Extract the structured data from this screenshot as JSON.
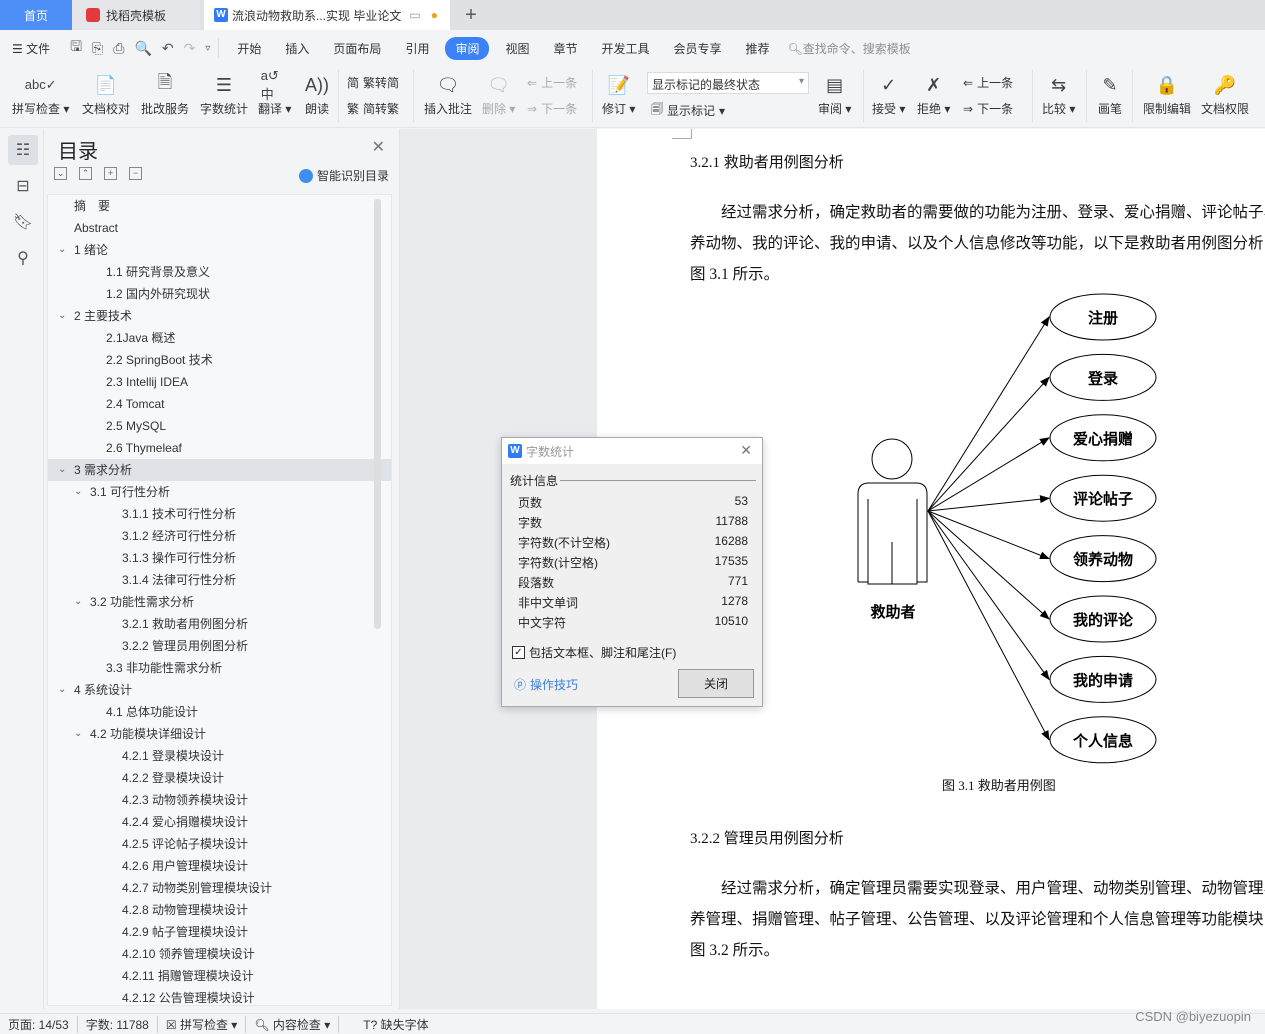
{
  "tabs": {
    "home": "首页",
    "template": "找稻壳模板",
    "document": "流浪动物救助系...实现 毕业论文",
    "add": "+"
  },
  "menu": {
    "file": "文件",
    "items": [
      "开始",
      "插入",
      "页面布局",
      "引用",
      "审阅",
      "视图",
      "章节",
      "开发工具",
      "会员专享",
      "推荐"
    ],
    "active": "审阅",
    "search_placeholder": "查找命令、搜索模板"
  },
  "ribbon": {
    "spell_check": "拼写检查",
    "doc_proof": "文档校对",
    "revise_service": "批改服务",
    "word_count": "字数统计",
    "translate": "翻译",
    "read_aloud": "朗读",
    "trad_to_simp": "繁转简",
    "simp_to_trad": "简转繁",
    "insert_comment": "插入批注",
    "delete": "删除",
    "prev_comment": "上一条",
    "next_comment": "下一条",
    "track_changes": "修订",
    "markup_state": "显示标记的最终状态",
    "show_markup": "显示标记",
    "review": "审阅",
    "accept": "接受",
    "reject": "拒绝",
    "prev_change": "上一条",
    "next_change": "下一条",
    "compare": "比较",
    "pen": "画笔",
    "restrict_edit": "限制编辑",
    "doc_permission": "文档权限"
  },
  "toc": {
    "title": "目录",
    "smart_detect": "智能识别目录",
    "items": [
      {
        "label": "摘　要",
        "level": 0,
        "chevron": false
      },
      {
        "label": "Abstract",
        "level": 0,
        "chevron": false
      },
      {
        "label": "1  绪论",
        "level": 0,
        "chevron": true
      },
      {
        "label": "1.1 研究背景及意义",
        "level": 1,
        "chevron": false
      },
      {
        "label": "1.2 国内外研究现状",
        "level": 1,
        "chevron": false
      },
      {
        "label": "2  主要技术",
        "level": 0,
        "chevron": true
      },
      {
        "label": "2.1Java 概述",
        "level": 1,
        "chevron": false
      },
      {
        "label": "2.2 SpringBoot 技术",
        "level": 1,
        "chevron": false
      },
      {
        "label": "2.3 Intellij IDEA",
        "level": 1,
        "chevron": false
      },
      {
        "label": "2.4 Tomcat",
        "level": 1,
        "chevron": false
      },
      {
        "label": "2.5 MySQL",
        "level": 1,
        "chevron": false
      },
      {
        "label": "2.6 Thymeleaf",
        "level": 1,
        "chevron": false
      },
      {
        "label": "3  需求分析",
        "level": 0,
        "chevron": true,
        "selected": true
      },
      {
        "label": "3.1 可行性分析",
        "level": 1,
        "chevron": true
      },
      {
        "label": "3.1.1  技术可行性分析",
        "level": 2,
        "chevron": false
      },
      {
        "label": "3.1.2  经济可行性分析",
        "level": 2,
        "chevron": false
      },
      {
        "label": "3.1.3  操作可行性分析",
        "level": 2,
        "chevron": false
      },
      {
        "label": "3.1.4  法律可行性分析",
        "level": 2,
        "chevron": false
      },
      {
        "label": "3.2  功能性需求分析",
        "level": 1,
        "chevron": true
      },
      {
        "label": "3.2.1 救助者用例图分析",
        "level": 2,
        "chevron": false
      },
      {
        "label": "3.2.2  管理员用例图分析",
        "level": 2,
        "chevron": false
      },
      {
        "label": "3.3  非功能性需求分析",
        "level": 1,
        "chevron": false
      },
      {
        "label": "4  系统设计",
        "level": 0,
        "chevron": true
      },
      {
        "label": "4.1  总体功能设计",
        "level": 1,
        "chevron": false
      },
      {
        "label": "4.2  功能模块详细设计",
        "level": 1,
        "chevron": true
      },
      {
        "label": "4.2.1  登录模块设计",
        "level": 2,
        "chevron": false
      },
      {
        "label": "4.2.2  登录模块设计",
        "level": 2,
        "chevron": false
      },
      {
        "label": "4.2.3  动物领养模块设计",
        "level": 2,
        "chevron": false
      },
      {
        "label": "4.2.4 爱心捐赠模块设计",
        "level": 2,
        "chevron": false
      },
      {
        "label": "4.2.5 评论帖子模块设计",
        "level": 2,
        "chevron": false
      },
      {
        "label": "4.2.6 用户管理模块设计",
        "level": 2,
        "chevron": false
      },
      {
        "label": "4.2.7 动物类别管理模块设计",
        "level": 2,
        "chevron": false
      },
      {
        "label": "4.2.8 动物管理模块设计",
        "level": 2,
        "chevron": false
      },
      {
        "label": "4.2.9 帖子管理模块设计",
        "level": 2,
        "chevron": false
      },
      {
        "label": "4.2.10 领养管理模块设计",
        "level": 2,
        "chevron": false
      },
      {
        "label": "4.2.11 捐赠管理模块设计",
        "level": 2,
        "chevron": false
      },
      {
        "label": "4.2.12 公告管理模块设计",
        "level": 2,
        "chevron": false
      }
    ]
  },
  "document": {
    "heading1": "3.2.1 救助者用例图分析",
    "para1": [
      "　　经过需求分析，确定救助者的需要做的功能为注册、登录、爱心捐赠、评论帖子、领",
      "养动物、我的评论、我的申请、以及个人信息修改等功能，以下是救助者用例图分析，如",
      "图 3.1 所示。"
    ],
    "diagram": {
      "actor": "救助者",
      "use_cases": [
        "注册",
        "登录",
        "爱心捐赠",
        "评论帖子",
        "领养动物",
        "我的评论",
        "我的申请",
        "个人信息"
      ]
    },
    "caption": "图 3.1 救助者用例图",
    "heading2": "3.2.2  管理员用例图分析",
    "para2": [
      "　　经过需求分析，确定管理员需要实现登录、用户管理、动物类别管理、动物管理、领",
      "养管理、捐赠管理、帖子管理、公告管理、以及评论管理和个人信息管理等功能模块，如",
      "图 3.2 所示。"
    ]
  },
  "dialog": {
    "title": "字数统计",
    "group": "统计信息",
    "rows": [
      {
        "label": "页数",
        "value": "53"
      },
      {
        "label": "字数",
        "value": "11788"
      },
      {
        "label": "字符数(不计空格)",
        "value": "16288"
      },
      {
        "label": "字符数(计空格)",
        "value": "17535"
      },
      {
        "label": "段落数",
        "value": "771"
      },
      {
        "label": "非中文单词",
        "value": "1278"
      },
      {
        "label": "中文字符",
        "value": "10510"
      }
    ],
    "include_checkbox": "包括文本框、脚注和尾注(F)",
    "include_checked": true,
    "tips": "操作技巧",
    "close": "关闭"
  },
  "status": {
    "page": "页面: 14/53",
    "words": "字数: 11788",
    "spell_check": "拼写检查",
    "content_check": "内容检查",
    "missing_font": "缺失字体"
  },
  "watermark": "CSDN @biyezuopin",
  "colors": {
    "accent": "#3b82f6",
    "home_tab": "#4e8ef7",
    "link": "#3c7fd7"
  }
}
